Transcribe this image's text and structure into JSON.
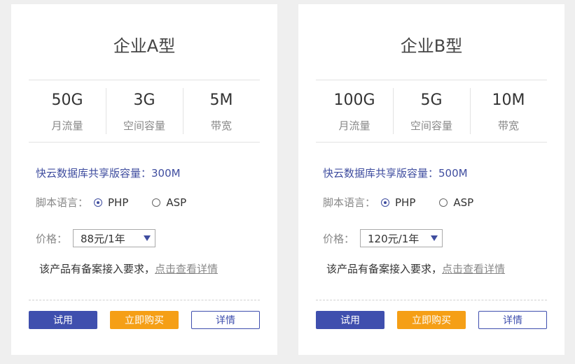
{
  "cards": [
    {
      "title": "企业A型",
      "specs": [
        {
          "value": "50G",
          "label": "月流量"
        },
        {
          "value": "3G",
          "label": "空间容量"
        },
        {
          "value": "5M",
          "label": "带宽"
        }
      ],
      "db_text": "快云数据库共享版容量：300M",
      "lang_label": "脚本语言：",
      "lang_options": [
        "PHP",
        "ASP"
      ],
      "price_label": "价格：",
      "price_selected": "88元/1年",
      "notice_text": "该产品有备案接入要求，",
      "notice_link": "点击查看详情",
      "btn_try": "试用",
      "btn_buy": "立即购买",
      "btn_detail": "详情"
    },
    {
      "title": "企业B型",
      "specs": [
        {
          "value": "100G",
          "label": "月流量"
        },
        {
          "value": "5G",
          "label": "空间容量"
        },
        {
          "value": "10M",
          "label": "带宽"
        }
      ],
      "db_text": "快云数据库共享版容量：500M",
      "lang_label": "脚本语言：",
      "lang_options": [
        "PHP",
        "ASP"
      ],
      "price_label": "价格：",
      "price_selected": "120元/1年",
      "notice_text": "该产品有备案接入要求，",
      "notice_link": "点击查看详情",
      "btn_try": "试用",
      "btn_buy": "立即购买",
      "btn_detail": "详情"
    }
  ],
  "colors": {
    "primary": "#3f4fae",
    "accent": "#f59f16",
    "background": "#efefef"
  }
}
